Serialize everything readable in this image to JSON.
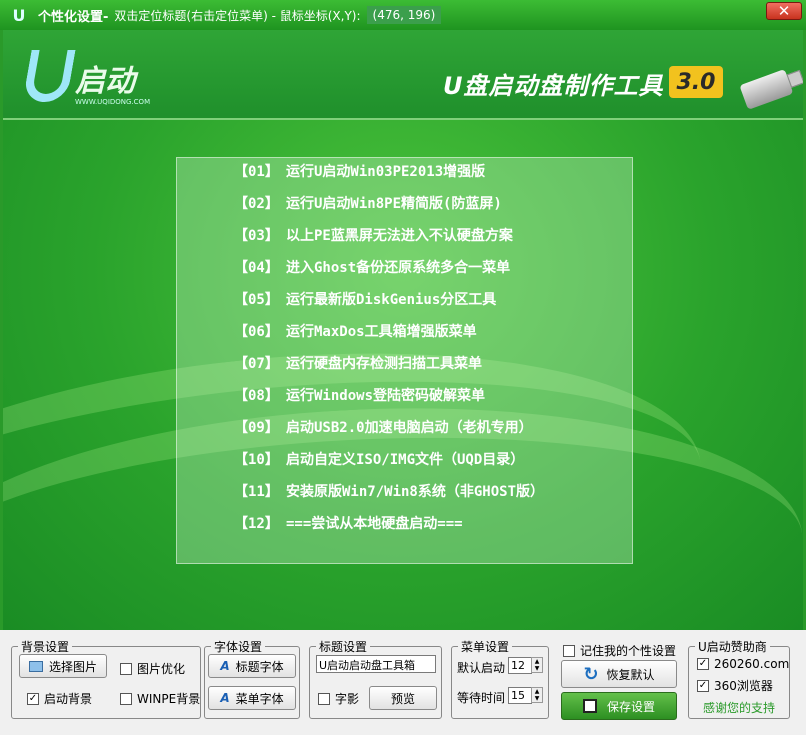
{
  "titlebar": {
    "app_name": "个性化设置-",
    "hint": "双击定位标题(右击定位菜单) - 鼠标坐标(X,Y):",
    "coords": "(476, 196)",
    "close_label": "✕"
  },
  "banner": {
    "logo_text": "启动",
    "logo_url": "WWW.UQIDONG.COM",
    "product_title": "U盘启动盘制作工具",
    "version": "3.0"
  },
  "menu": [
    {
      "num": "【01】",
      "label": "运行U启动Win03PE2013增强版"
    },
    {
      "num": "【02】",
      "label": "运行U启动Win8PE精简版(防蓝屏)"
    },
    {
      "num": "【03】",
      "label": "以上PE蓝黑屏无法进入不认硬盘方案"
    },
    {
      "num": "【04】",
      "label": "进入Ghost备份还原系统多合一菜单"
    },
    {
      "num": "【05】",
      "label": "运行最新版DiskGenius分区工具"
    },
    {
      "num": "【06】",
      "label": "运行MaxDos工具箱增强版菜单"
    },
    {
      "num": "【07】",
      "label": "运行硬盘内存检测扫描工具菜单"
    },
    {
      "num": "【08】",
      "label": "运行Windows登陆密码破解菜单"
    },
    {
      "num": "【09】",
      "label": "启动USB2.0加速电脑启动（老机专用）"
    },
    {
      "num": "【10】",
      "label": "启动自定义ISO/IMG文件（UQD目录）"
    },
    {
      "num": "【11】",
      "label": "安装原版Win7/Win8系统（非GHOST版）"
    },
    {
      "num": "【12】",
      "label": "===尝试从本地硬盘启动==="
    }
  ],
  "bottom": {
    "bg_group": "背景设置",
    "select_image": "选择图片",
    "image_optimize": "图片优化",
    "boot_bg": "启动背景",
    "boot_bg_checked": "✓",
    "winpe_bg": "WINPE背景",
    "font_group": "字体设置",
    "title_font": "标题字体",
    "menu_font": "菜单字体",
    "title_group": "标题设置",
    "title_value": "U启动启动盘工具箱",
    "shadow": "字影",
    "preview": "预览",
    "menu_group": "菜单设置",
    "default_boot": "默认启动",
    "default_boot_value": "12",
    "wait_time": "等待时间",
    "wait_time_value": "15",
    "remember": "记住我的个性设置",
    "restore": "恢复默认",
    "save": "保存设置",
    "sponsor_group": "U启动赞助商",
    "sponsor1": "260260.com",
    "sponsor2": "360浏览器",
    "check_mark": "✓",
    "thanks": "感谢您的支持"
  }
}
